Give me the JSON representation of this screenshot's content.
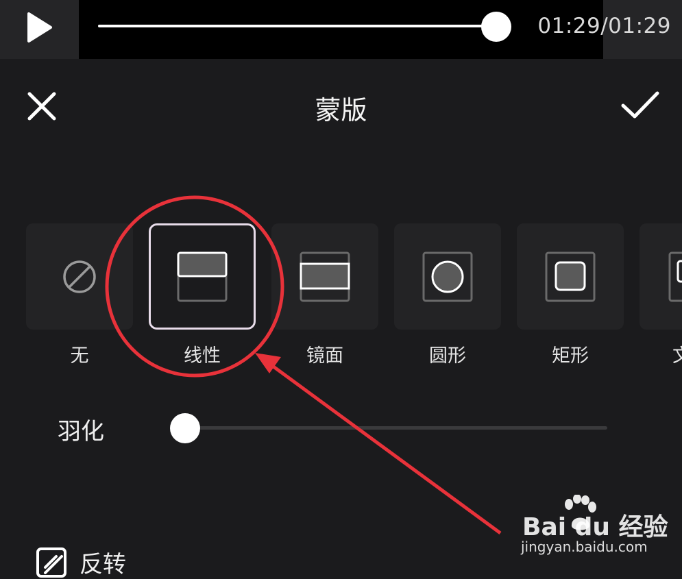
{
  "player": {
    "time": "01:29/01:29",
    "progress": 1.0
  },
  "header": {
    "title": "蒙版"
  },
  "masks": [
    {
      "label": "无",
      "icon": "none-icon",
      "selected": false
    },
    {
      "label": "线性",
      "icon": "linear-mask-icon",
      "selected": true
    },
    {
      "label": "镜面",
      "icon": "mirror-mask-icon",
      "selected": false
    },
    {
      "label": "圆形",
      "icon": "circle-mask-icon",
      "selected": false
    },
    {
      "label": "矩形",
      "icon": "rectangle-mask-icon",
      "selected": false
    },
    {
      "label": "文",
      "icon": "text-mask-icon",
      "selected": false
    }
  ],
  "feather": {
    "label": "羽化",
    "value": 0
  },
  "invert": {
    "label": "反转"
  },
  "watermark": {
    "logo": "Bai du 经验",
    "url": "jingyan.baidu.com"
  },
  "colors": {
    "background": "#1b1b1d",
    "tile": "#232325",
    "selected_border": "#e8dcea",
    "annotation_red": "#e8323a"
  }
}
